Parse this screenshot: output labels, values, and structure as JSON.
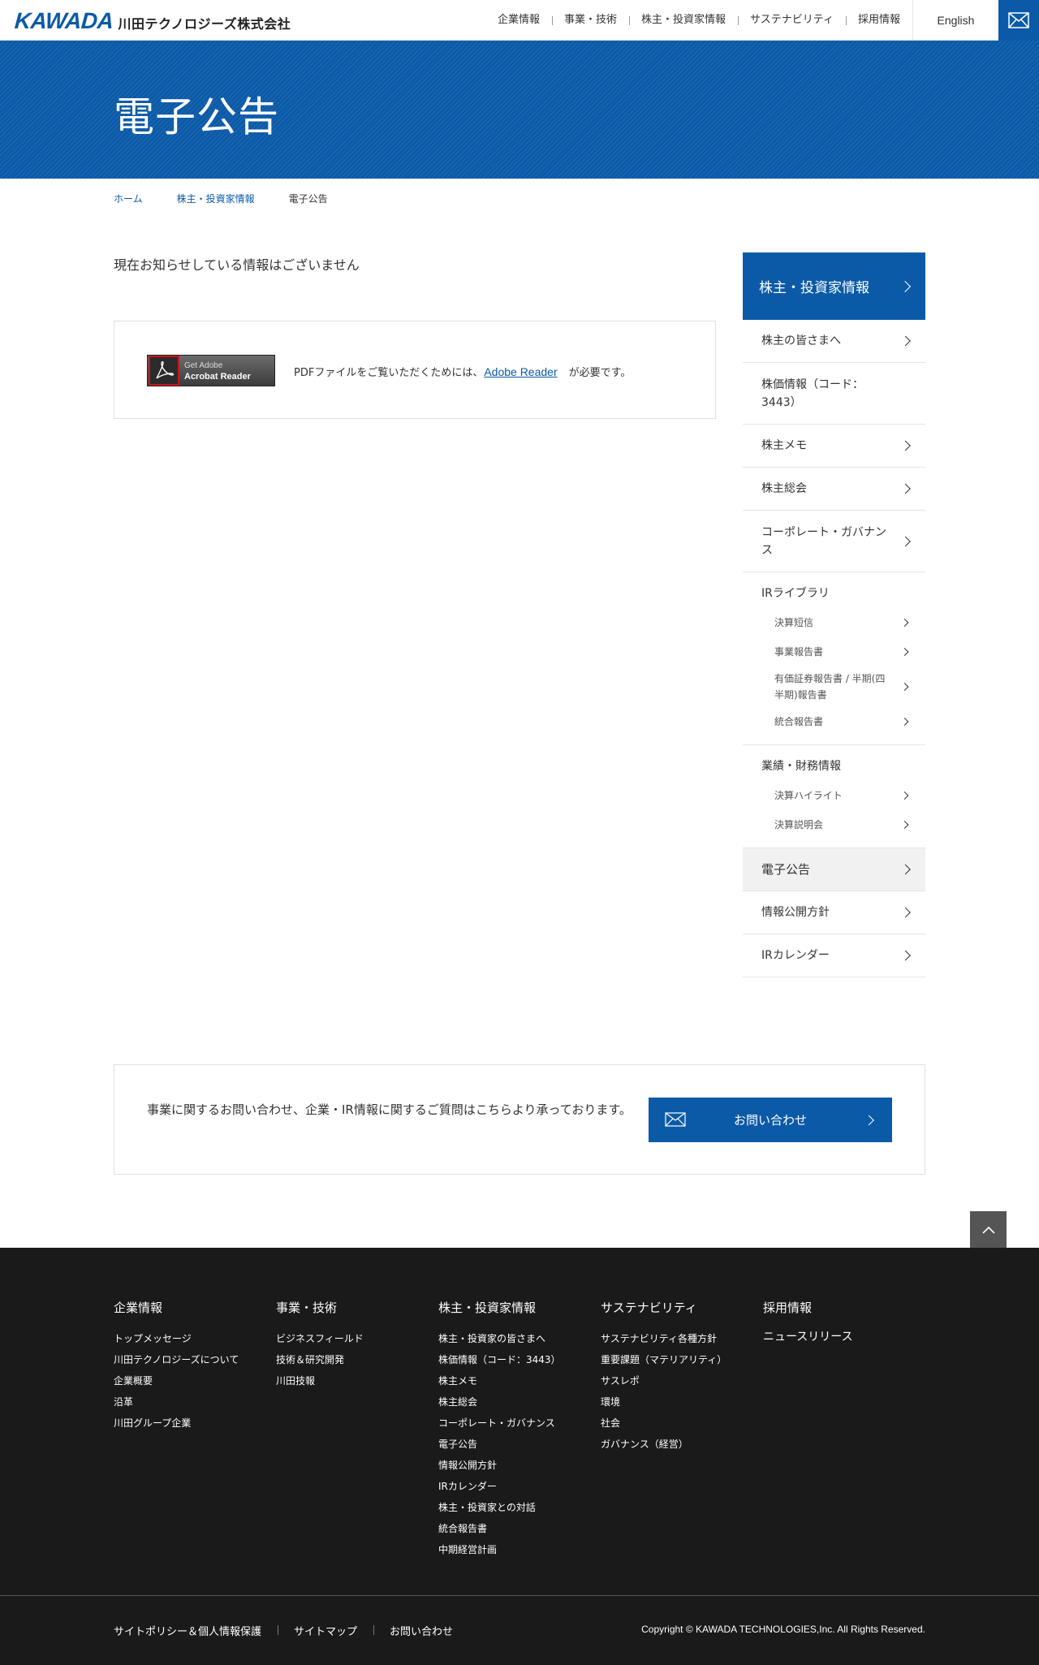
{
  "header": {
    "logo_en": "KAWADA",
    "logo_jp": "川田テクノロジーズ株式会社",
    "nav": [
      "企業情報",
      "事業・技術",
      "株主・投資家情報",
      "サステナビリティ",
      "採用情報"
    ],
    "lang": "English",
    "mail_icon": "mail-icon"
  },
  "hero": {
    "title": "電子公告"
  },
  "breadcrumb": {
    "home": "ホーム",
    "parent": "株主・投資家情報",
    "current": "電子公告"
  },
  "main": {
    "notice": "現在お知らせしている情報はございません",
    "acrobat": {
      "line1": "Get Adobe",
      "line2": "Acrobat Reader"
    },
    "pdf_text_before": "PDFファイルをご覧いただくためには、",
    "pdf_link": "Adobe Reader",
    "pdf_text_after": "が必要です。"
  },
  "sidebar": {
    "title": "株主・投資家情報",
    "items": [
      "株主の皆さまへ",
      "株価情報（コード：3443）",
      "株主メモ",
      "株主総会",
      "コーポレート・ガバナンス"
    ],
    "ir_library": {
      "label": "IRライブラリ",
      "subs": [
        "決算短信",
        "事業報告書",
        "有価証券報告書 / 半期(四半期)報告書",
        "統合報告書"
      ]
    },
    "financial": {
      "label": "業績・財務情報",
      "subs": [
        "決算ハイライト",
        "決算説明会"
      ]
    },
    "tail_items": [
      "電子公告",
      "情報公開方針",
      "IRカレンダー"
    ]
  },
  "contact": {
    "text": "事業に関するお問い合わせ、企業・IR情報に関するご質問はこちらより承っております。",
    "button": "お問い合わせ"
  },
  "footer": {
    "columns": [
      {
        "title": "企業情報",
        "links": [
          "トップメッセージ",
          "川田テクノロジーズについて",
          "企業概要",
          "沿革",
          "川田グループ企業"
        ]
      },
      {
        "title": "事業・技術",
        "links": [
          "ビジネスフィールド",
          "技術＆研究開発",
          "川田技報"
        ]
      },
      {
        "title": "株主・投資家情報",
        "links": [
          "株主・投資家の皆さまへ",
          "株価情報（コード：3443）",
          "株主メモ",
          "株主総会",
          "コーポレート・ガバナンス",
          "電子公告",
          "情報公開方針",
          "IRカレンダー",
          "株主・投資家との対話",
          "統合報告書",
          "中期経営計画"
        ]
      },
      {
        "title": "サステナビリティ",
        "links": [
          "サステナビリティ各種方針",
          "重要課題（マテリアリティ）",
          "サスレポ",
          "環境",
          "社会",
          "ガバナンス（経営）"
        ]
      },
      {
        "title": "採用情報",
        "links": [
          "ニュースリリース"
        ]
      }
    ],
    "bottom_nav": [
      "サイトポリシー＆個人情報保護",
      "サイトマップ",
      "お問い合わせ"
    ],
    "copyright": "Copyright © KAWADA TECHNOLOGIES,Inc. All Rights Reserved."
  }
}
